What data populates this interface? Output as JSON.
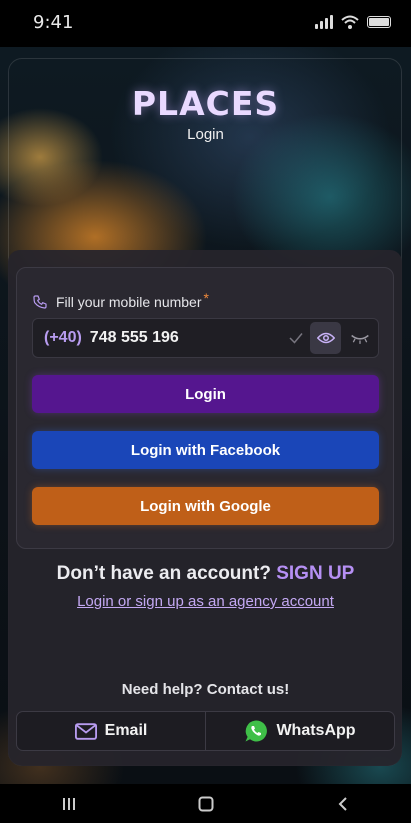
{
  "status_bar": {
    "time": "9:41"
  },
  "app": {
    "brand": "PLACES",
    "subtitle": "Login"
  },
  "form": {
    "phone_label": "Fill your mobile number",
    "required_marker": "*",
    "country_code": "(+40)",
    "phone_value": "748 555 196"
  },
  "buttons": {
    "login": "Login",
    "facebook": "Login with Facebook",
    "google": "Login with Google"
  },
  "signup": {
    "prompt": "Don’t have an account?",
    "link": "SIGN UP",
    "agency_link": "Login or sign up as an agency account"
  },
  "help": {
    "text": "Need help? Contact us!"
  },
  "contact": {
    "email": "Email",
    "whatsapp": "WhatsApp"
  },
  "colors": {
    "brand": "#e9d9ff",
    "login_button": "#55168f",
    "facebook_button": "#1a46b8",
    "google_button": "#bf5f18",
    "accent_link": "#b690f4",
    "whatsapp_green": "#3fbf48"
  },
  "icons": [
    "phone-icon",
    "check-icon",
    "eye-icon",
    "eye-closed-icon",
    "mail-icon",
    "whatsapp-icon",
    "signal-icon",
    "wifi-icon",
    "battery-icon",
    "recents-icon",
    "home-icon",
    "back-icon"
  ]
}
